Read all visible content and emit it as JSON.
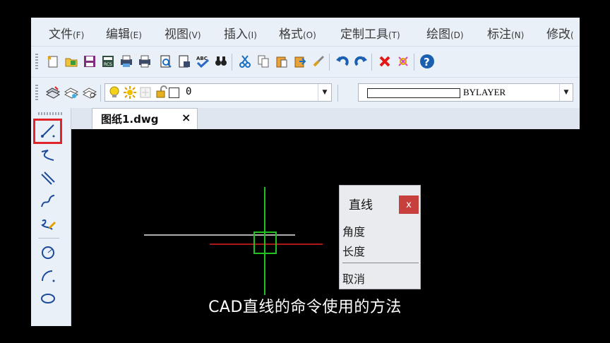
{
  "menu": [
    {
      "label": "文件",
      "key": "(F)"
    },
    {
      "label": "编辑",
      "key": "(E)"
    },
    {
      "label": "视图",
      "key": "(V)"
    },
    {
      "label": "插入",
      "key": "(I)"
    },
    {
      "label": "格式",
      "key": "(O)"
    },
    {
      "label": "定制工具",
      "key": "(T)"
    },
    {
      "label": "绘图",
      "key": "(D)"
    },
    {
      "label": "标注",
      "key": "(N)"
    },
    {
      "label": "修改",
      "key": "("
    }
  ],
  "toolbar_standard": [
    "new-icon",
    "open-icon",
    "save-icon",
    "recover-icon",
    "plot-icon",
    "print-icon",
    "preview-icon",
    "publish-icon",
    "spellcheck-icon",
    "find-icon",
    "cut-icon",
    "copy-icon",
    "paste-icon",
    "match-icon",
    "brush-icon",
    "undo-icon",
    "redo-icon",
    "delete-icon",
    "erase-icon",
    "help-icon"
  ],
  "properties": {
    "layer_value": "0",
    "linetype_value": "BYLAYER"
  },
  "tab": {
    "label": "图纸1.dwg",
    "close": "×"
  },
  "draw_tools": [
    "line-icon",
    "polyline-icon",
    "double-line-icon",
    "spline-icon",
    "freehand-icon",
    "circle-icon",
    "arc-icon",
    "ellipse-icon"
  ],
  "popup": {
    "title": "直线",
    "close": "x",
    "items": [
      "角度",
      "长度",
      "取消"
    ]
  },
  "caption": "CAD直线的命令使用的方法",
  "colors": {
    "crosshair": "#1fc21f",
    "red_axis": "#e02020",
    "white_line": "#e8e8e8",
    "highlight": "#e0242b"
  }
}
